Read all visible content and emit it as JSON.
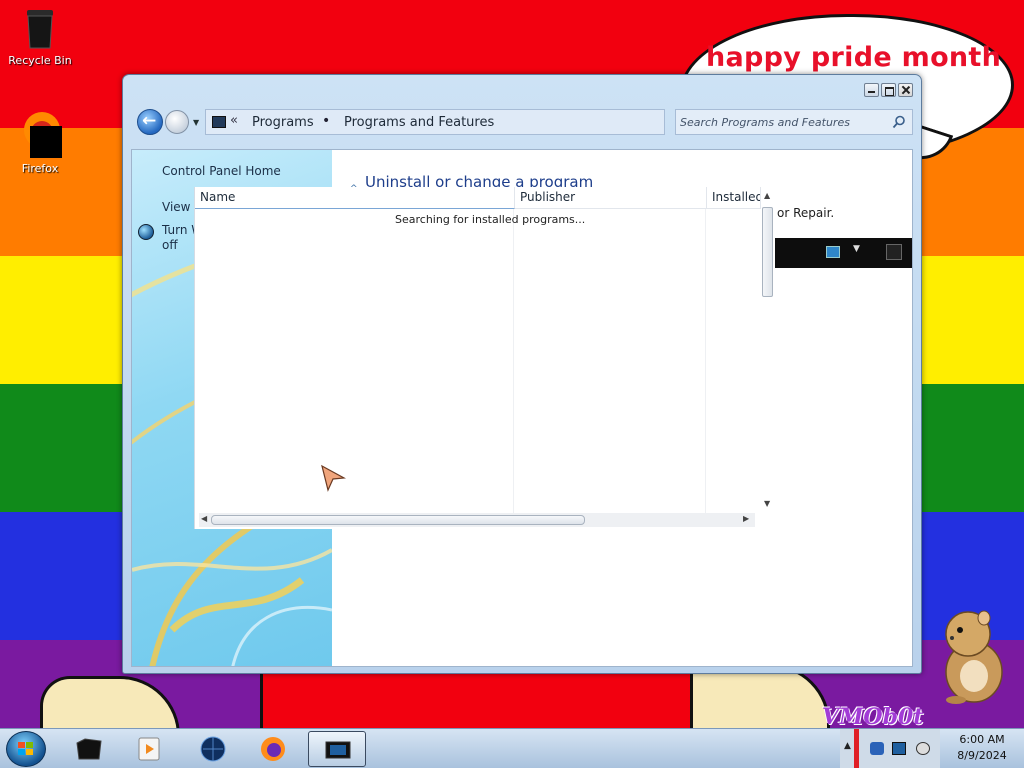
{
  "desktop": {
    "wallpaper_colors": [
      "#f2000f",
      "#ff7c00",
      "#ffee00",
      "#108a1a",
      "#2330e0",
      "#7a1aa0"
    ],
    "speech_bubble_text": "happy pride month",
    "watermark_text": "VMOb0t",
    "icons": [
      {
        "label": "Recycle Bin",
        "icon": "recycle-bin-icon"
      },
      {
        "label": "Firefox",
        "icon": "firefox-icon"
      }
    ]
  },
  "window": {
    "title": "Programs and Features",
    "address": {
      "chevron": "«",
      "parts": [
        "Programs",
        "Programs and Features"
      ],
      "separator": "•"
    },
    "search_placeholder": "Search Programs and Features",
    "left_pane": {
      "links": [
        "Control Panel Home",
        "View i",
        "Turn W",
        "off"
      ]
    },
    "main_title": "Uninstall or change a program",
    "repair_hint": "or Repair.",
    "columns": [
      "Name",
      "Publisher",
      "Installed"
    ],
    "status_message": "Searching for installed programs..."
  },
  "taskbar": {
    "items": [
      {
        "name": "explorer",
        "icon": "folder-icon",
        "active": false
      },
      {
        "name": "media-player",
        "icon": "media-player-icon",
        "active": false
      },
      {
        "name": "browser-globe",
        "icon": "globe-icon",
        "active": false
      },
      {
        "name": "firefox",
        "icon": "firefox-icon",
        "active": false
      },
      {
        "name": "control-panel",
        "icon": "control-panel-icon",
        "active": true
      }
    ],
    "clock": {
      "time": "6:00 AM",
      "date": "8/9/2024"
    }
  },
  "colors": {
    "title_blue": "#1e3e8b",
    "window_frame": "#cde2f5",
    "taskbar": "#bfd3e8"
  }
}
